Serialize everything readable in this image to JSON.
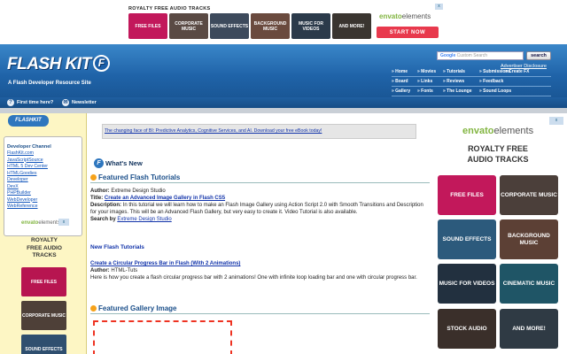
{
  "top_ad": {
    "title": "ROYALTY FREE AUDIO TRACKS",
    "tiles": [
      {
        "label": "FREE FILES",
        "color": "#c2185b"
      },
      {
        "label": "CORPORATE MUSIC",
        "color": "#5a4a44"
      },
      {
        "label": "SOUND EFFECTS",
        "color": "#3d4a5c"
      },
      {
        "label": "BACKGROUND MUSIC",
        "color": "#6a4a3e"
      },
      {
        "label": "MUSIC FOR VIDEOS",
        "color": "#2b3a4a"
      },
      {
        "label": "AND MORE!",
        "color": "#3a3530"
      }
    ],
    "brand_prefix": "envato",
    "brand_suffix": "elements",
    "cta": "START NOW",
    "close": "x"
  },
  "header": {
    "logo_text": "FLASH KIT",
    "logo_mark": "F",
    "tagline": "A Flash Developer Resource Site",
    "search_brand": "Google",
    "search_placeholder": "Custom Search",
    "search_button": "search",
    "advertiser_link": "Advertiser Disclosure",
    "nav": [
      [
        "» Home",
        "» Movies",
        "» Tutorials",
        "» Submissions",
        "» Create FX"
      ],
      [
        "» Board",
        "» Links",
        "» Reviews",
        "» Feedback"
      ],
      [
        "» Gallery",
        "» Fonts",
        "» The Lounge",
        "» Sound Loops"
      ]
    ]
  },
  "subbar": {
    "first_time": "First time here?",
    "newsletter": "Newsletter"
  },
  "sidebar": {
    "logo": "FLASHKIT",
    "dev_channel_title": "Developer Channel",
    "dev_links": [
      "FlashKit.com",
      "JavaScriptSource",
      "HTML 5 Dev Center",
      "HTMLGoodies",
      "Developer",
      "DevX",
      "PHPBuilder",
      "WebDeveloper",
      "WebReference"
    ],
    "ad_brand_prefix": "envato",
    "ad_brand_suffix": "elements",
    "ad_close": "x",
    "ad_title": "ROYALTY FREE AUDIO TRACKS",
    "ad_tiles": [
      {
        "label": "FREE FILES",
        "color": "#b71550"
      },
      {
        "label": "CORPORATE MUSIC",
        "color": "#4e4038"
      },
      {
        "label": "SOUND EFFECTS",
        "color": "#2f4f6f"
      }
    ]
  },
  "main": {
    "banner_link": "The changing face of BI: Predictive Analytics, Cognitive Services, and AI. Download your free eBook today!",
    "whats_new": "What's New",
    "featured_tutorials_title": "Featured Flash Tutorials",
    "featured": {
      "author_label": "Author:",
      "author": "Extreme Design Studio",
      "title_label": "Title:",
      "title": "Create an Advanced Image Gallery in Flash CS5",
      "desc_label": "Description:",
      "desc": "In this tutorial we will learn how to make an Flash Image Gallery using Action Script 2.0 with Smooth Transitions and Description for your images. This will be an Advanced Flash Gallery, but very easy to create it. Video Tutorial is also available.",
      "search_label": "Search by",
      "search_link": "Extreme Design Studio"
    },
    "new_tutorials_title": "New Flash Tutorials",
    "new_tut": {
      "title": "Create a Circular Progress Bar in Flash (With 2 Animations)",
      "author_label": "Author:",
      "author": "HTML-Tuts",
      "desc": "Here is how you create a flash circular progress bar with 2 animations! One with infinite loop loading bar and one with circular progress bar."
    },
    "featured_gallery_title": "Featured Gallery Image"
  },
  "right_ad": {
    "close": "x",
    "brand_prefix": "envato",
    "brand_suffix": "elements",
    "title": "ROYALTY FREE AUDIO TRACKS",
    "tiles": [
      {
        "label": "FREE FILES",
        "color": "#c2185b"
      },
      {
        "label": "CORPORATE MUSIC",
        "color": "#4b3f3a"
      },
      {
        "label": "SOUND EFFECTS",
        "color": "#2c5a7c"
      },
      {
        "label": "BACKGROUND MUSIC",
        "color": "#5c4035"
      },
      {
        "label": "MUSIC FOR VIDEOS",
        "color": "#22303f"
      },
      {
        "label": "CINEMATIC MUSIC",
        "color": "#1f5566"
      },
      {
        "label": "STOCK AUDIO",
        "color": "#3a2f2a"
      },
      {
        "label": "AND MORE!",
        "color": "#2f3a44"
      }
    ]
  }
}
